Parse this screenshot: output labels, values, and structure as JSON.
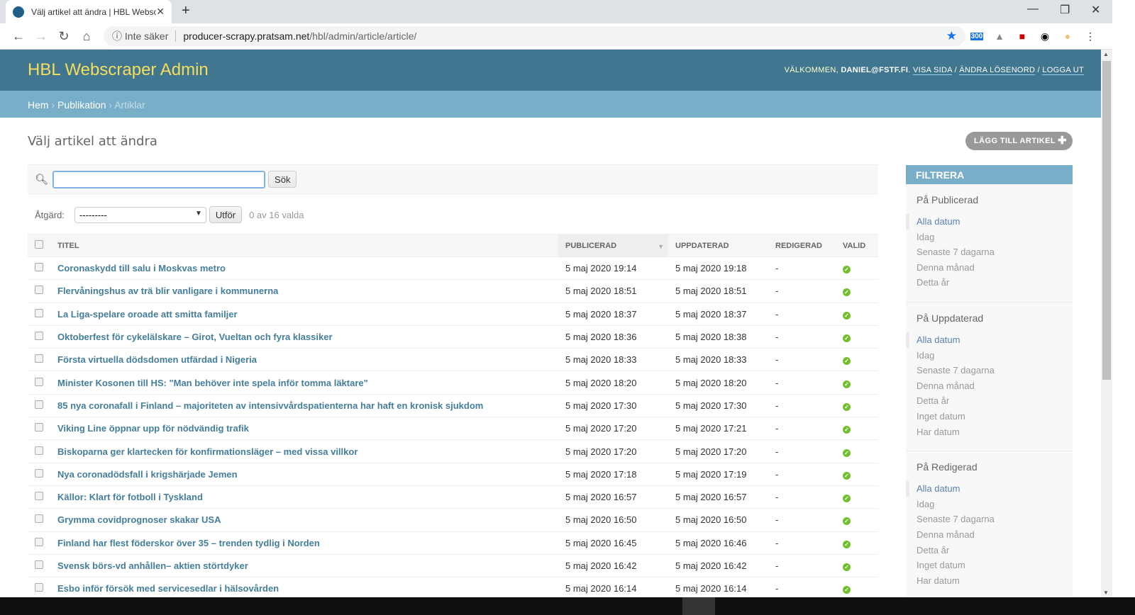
{
  "browser": {
    "tab_title": "Välj artikel att ändra | HBL Webscraper Admin",
    "security": "Inte säker",
    "url_host": "producer-scrapy.pratsam.net",
    "url_path": "/hbl/admin/article/article/",
    "ext_badge": "300"
  },
  "header": {
    "brand": "HBL Webscraper Admin",
    "welcome": "VÄLKOMMEN,",
    "user": "DANIEL@FSTF.FI",
    "view_site": "VISA SIDA",
    "change_password": "ÄNDRA LÖSENORD",
    "logout": "LOGGA UT"
  },
  "breadcrumbs": {
    "home": "Hem",
    "app": "Publikation",
    "current": "Artiklar"
  },
  "page": {
    "title": "Välj artikel att ändra",
    "add_button": "LÄGG TILL ARTIKEL"
  },
  "search": {
    "value": "",
    "button": "Sök"
  },
  "actions": {
    "label": "Åtgärd:",
    "selected": "---------",
    "go": "Utför",
    "counter": "0 av 16 valda"
  },
  "table": {
    "columns": [
      "TITEL",
      "PUBLICERAD",
      "UPPDATERAD",
      "REDIGERAD",
      "VALID"
    ],
    "rows": [
      {
        "title": "Coronaskydd till salu i Moskvas metro",
        "published": "5 maj 2020 19:14",
        "updated": "5 maj 2020 19:18",
        "edited": "-",
        "valid": true
      },
      {
        "title": "Flervåningshus av trä blir vanligare i kommunerna",
        "published": "5 maj 2020 18:51",
        "updated": "5 maj 2020 18:51",
        "edited": "-",
        "valid": true
      },
      {
        "title": "La Liga-spelare oroade att smitta familjer",
        "published": "5 maj 2020 18:37",
        "updated": "5 maj 2020 18:37",
        "edited": "-",
        "valid": true
      },
      {
        "title": "Oktoberfest för cykelälskare – Girot, Vueltan och fyra klassiker",
        "published": "5 maj 2020 18:36",
        "updated": "5 maj 2020 18:38",
        "edited": "-",
        "valid": true
      },
      {
        "title": "Första virtuella dödsdomen utfärdad i Nigeria",
        "published": "5 maj 2020 18:33",
        "updated": "5 maj 2020 18:33",
        "edited": "-",
        "valid": true
      },
      {
        "title": "Minister Kosonen till HS: \"Man behöver inte spela inför tomma läktare\"",
        "published": "5 maj 2020 18:20",
        "updated": "5 maj 2020 18:20",
        "edited": "-",
        "valid": true
      },
      {
        "title": "85 nya coronafall i Finland – majoriteten av intensivvårdspatienterna har haft en kronisk sjukdom",
        "published": "5 maj 2020 17:30",
        "updated": "5 maj 2020 17:30",
        "edited": "-",
        "valid": true
      },
      {
        "title": "Viking Line öppnar upp för nödvändig trafik",
        "published": "5 maj 2020 17:20",
        "updated": "5 maj 2020 17:21",
        "edited": "-",
        "valid": true
      },
      {
        "title": "Biskoparna ger klartecken för konfirmationsläger – med vissa villkor",
        "published": "5 maj 2020 17:20",
        "updated": "5 maj 2020 17:20",
        "edited": "-",
        "valid": true
      },
      {
        "title": "Nya coronadödsfall i krigshärjade Jemen",
        "published": "5 maj 2020 17:18",
        "updated": "5 maj 2020 17:19",
        "edited": "-",
        "valid": true
      },
      {
        "title": "Källor: Klart för fotboll i Tyskland",
        "published": "5 maj 2020 16:57",
        "updated": "5 maj 2020 16:57",
        "edited": "-",
        "valid": true
      },
      {
        "title": "Grymma covidprognoser skakar USA",
        "published": "5 maj 2020 16:50",
        "updated": "5 maj 2020 16:50",
        "edited": "-",
        "valid": true
      },
      {
        "title": "Finland har flest föderskor över 35 – trenden tydlig i Norden",
        "published": "5 maj 2020 16:45",
        "updated": "5 maj 2020 16:46",
        "edited": "-",
        "valid": true
      },
      {
        "title": "Svensk börs-vd anhållen– aktien störtdyker",
        "published": "5 maj 2020 16:42",
        "updated": "5 maj 2020 16:42",
        "edited": "-",
        "valid": true
      },
      {
        "title": "Esbo inför försök med servicesedlar i hälsovården",
        "published": "5 maj 2020 16:14",
        "updated": "5 maj 2020 16:14",
        "edited": "-",
        "valid": true
      }
    ]
  },
  "filter": {
    "title": "FILTRERA",
    "groups": [
      {
        "title": "På Publicerad",
        "options": [
          "Alla datum",
          "Idag",
          "Senaste 7 dagarna",
          "Denna månad",
          "Detta år"
        ]
      },
      {
        "title": "På Uppdaterad",
        "options": [
          "Alla datum",
          "Idag",
          "Senaste 7 dagarna",
          "Denna månad",
          "Detta år",
          "Inget datum",
          "Har datum"
        ]
      },
      {
        "title": "På Redigerad",
        "options": [
          "Alla datum",
          "Idag",
          "Senaste 7 dagarna",
          "Denna månad",
          "Detta år",
          "Inget datum",
          "Har datum"
        ]
      }
    ]
  },
  "colors": {
    "header": "#417690",
    "breadcrumbs": "#79aec8",
    "brand": "#f5dd5d",
    "link": "#447e9b",
    "valid": "#70bf2b"
  }
}
